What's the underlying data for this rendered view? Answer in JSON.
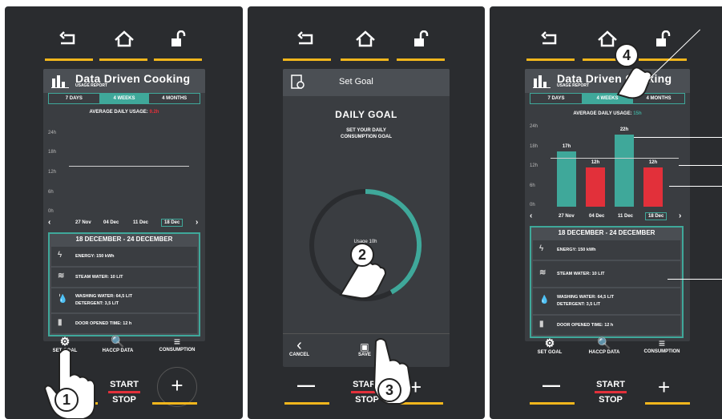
{
  "colors": {
    "accent": "#3fa89a",
    "yellow": "#f1b61c",
    "red": "#e2303a",
    "panel": "#2a2c2f",
    "screen": "#3a3d41"
  },
  "icons": [
    "back-icon",
    "home-icon",
    "unlock-icon"
  ],
  "report": {
    "title": "Data Driven Cooking",
    "subtitle": "USAGE REPORT",
    "tabs": [
      "7 DAYS",
      "4 WEEKS",
      "4 MONTHS"
    ],
    "active_tab": "4 WEEKS",
    "avg_label": "AVERAGE DAILY USAGE:",
    "avg_value_1": "9.2h",
    "avg_value_3": "15h",
    "y_ticks": [
      "24h",
      "18h",
      "12h",
      "6h",
      "0h"
    ],
    "dates": [
      "27 Nov",
      "04 Dec",
      "11 Dec",
      "18 Dec"
    ],
    "selected_date": "18 Dec",
    "week_title": "18 DECEMBER - 24 DECEMBER",
    "rows": [
      {
        "icon": "energy-icon",
        "text": "ENERGY: 150 kWh"
      },
      {
        "icon": "steam-icon",
        "text": "STEAM WATER: 10 LIT"
      },
      {
        "icon": "water-icon",
        "text": "WASHING WATER: 64,5 LIT",
        "text2": "DETERGENT: 3,5 LIT"
      },
      {
        "icon": "door-icon",
        "text": "DOOR OPENED TIME: 12 h"
      }
    ],
    "menu": [
      "SET GOAL",
      "HACCP DATA",
      "CONSUMPTION"
    ]
  },
  "chart_data": {
    "type": "bar",
    "categories": [
      "27 Nov",
      "04 Dec",
      "11 Dec",
      "18 Dec"
    ],
    "values": [
      17,
      12,
      22,
      12
    ],
    "bar_labels": [
      "17h",
      "12h",
      "22h",
      "12h"
    ],
    "ylim": [
      0,
      24
    ],
    "average": 15
  },
  "goal": {
    "title": "Set Goal",
    "heading": "DAILY GOAL",
    "sub1": "SET YOUR DAILY",
    "sub2": "CONSUMPTION GOAL",
    "gauge_label": "Usage 10h",
    "gauge_fraction": 0.42,
    "cancel": "CANCEL",
    "save": "SAVE"
  },
  "controls": {
    "start": "START",
    "stop": "STOP",
    "minus": "—",
    "plus": "+"
  },
  "callouts": [
    "1",
    "2",
    "3",
    "4"
  ]
}
